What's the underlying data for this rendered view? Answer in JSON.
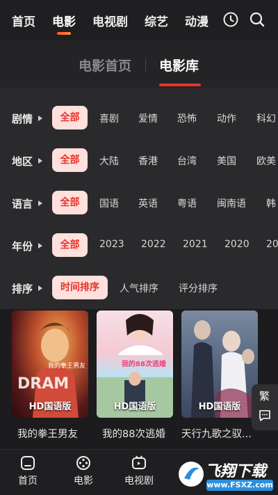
{
  "topnav": {
    "tabs": [
      {
        "label": "首页"
      },
      {
        "label": "电影"
      },
      {
        "label": "电视剧"
      },
      {
        "label": "综艺"
      },
      {
        "label": "动漫"
      }
    ],
    "active_index": 1,
    "icons": [
      "clock-icon",
      "search-icon"
    ]
  },
  "subtabs": {
    "items": [
      {
        "label": "电影首页"
      },
      {
        "label": "电影库"
      }
    ],
    "active_index": 1
  },
  "filters": {
    "rows": [
      {
        "label": "剧情",
        "options": [
          "全部",
          "喜剧",
          "爱情",
          "恐怖",
          "动作",
          "科幻"
        ],
        "selected": "全部"
      },
      {
        "label": "地区",
        "options": [
          "全部",
          "大陆",
          "香港",
          "台湾",
          "美国",
          "欧美"
        ],
        "selected": "全部"
      },
      {
        "label": "语言",
        "options": [
          "全部",
          "国语",
          "英语",
          "粤语",
          "闽南语",
          "韩"
        ],
        "selected": "全部"
      },
      {
        "label": "年份",
        "options": [
          "全部",
          "2023",
          "2022",
          "2021",
          "2020",
          "20"
        ],
        "selected": "全部"
      },
      {
        "label": "排序",
        "options": [
          "时间排序",
          "人气排序",
          "评分排序"
        ],
        "selected": "时间排序"
      }
    ]
  },
  "cards": [
    {
      "title": "我的拳王男友",
      "badge": "HD国语版",
      "poster_text": "我的拳王男友"
    },
    {
      "title": "我的88次逃婚",
      "badge": "HD国语版",
      "poster_text": "我的88次逃婚"
    },
    {
      "title": "天行九歌之驭...",
      "badge": "HD国语版"
    }
  ],
  "side": {
    "traditional_label": "繁",
    "icon": "message-icon"
  },
  "bottomnav": {
    "items": [
      {
        "label": "首页",
        "icon": "home-icon"
      },
      {
        "label": "电影",
        "icon": "film-reel-icon"
      },
      {
        "label": "电视剧",
        "icon": "tv-icon"
      }
    ]
  },
  "watermark": {
    "text": "飞翔下载",
    "url": "www.FSXZ.com"
  },
  "colors": {
    "accent": "#e8342c",
    "pill_bg": "#ffe0dc",
    "background": "#1c1c1e"
  }
}
